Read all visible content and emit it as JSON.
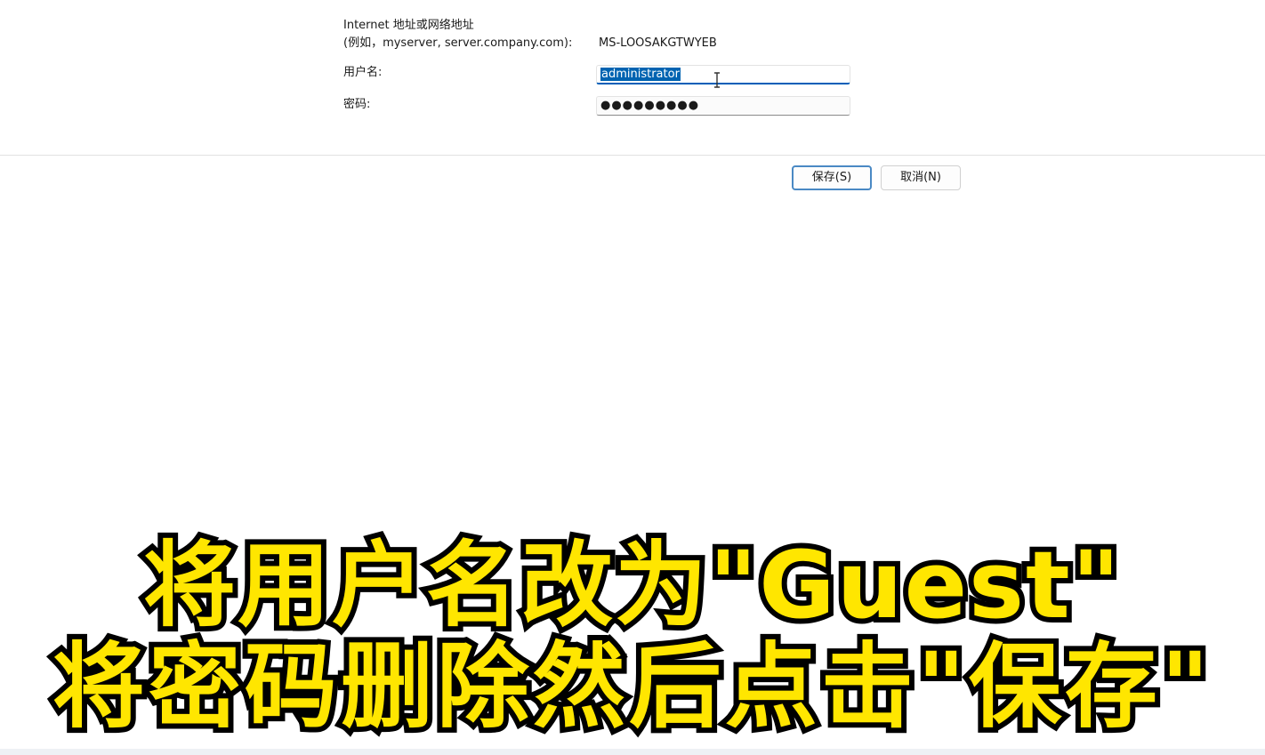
{
  "form": {
    "address_label_line1": "Internet 地址或网络地址",
    "address_label_line2": "(例如，myserver, server.company.com):",
    "address_value": "MS-LOOSAKGTWYEB",
    "username_label": "用户名:",
    "username_value": "administrator",
    "password_label": "密码:",
    "password_value": "●●●●●●●●●"
  },
  "buttons": {
    "save_label": "保存(S)",
    "cancel_label": "取消(N)"
  },
  "caption": {
    "line1": "将用户名改为\"Guest\"",
    "line2": "将密码删除然后点击\"保存\""
  },
  "colors": {
    "selection": "#0063b1",
    "focus_underline": "#005fb8",
    "caption_fill": "#ffe600",
    "caption_stroke": "#000000"
  },
  "icons": {
    "cursor": "text-cursor-ibeam-icon"
  }
}
